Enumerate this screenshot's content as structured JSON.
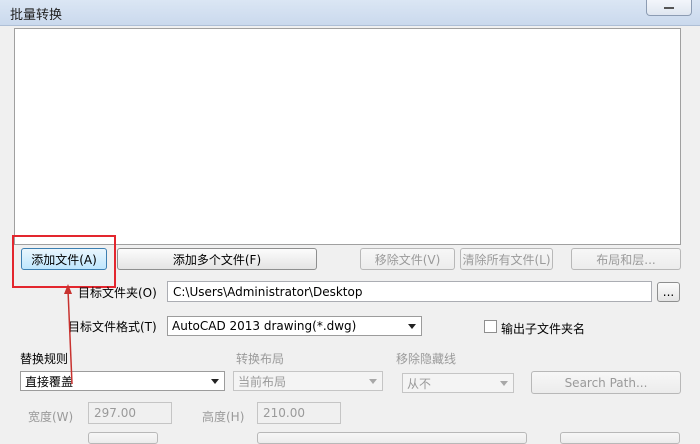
{
  "window": {
    "title": "批量转换"
  },
  "buttons": {
    "add_file": "添加文件(A)",
    "add_multiple": "添加多个文件(F)",
    "remove_file": "移除文件(V)",
    "clear_all": "清除所有文件(L)",
    "layouts": "布局和层...",
    "browse": "...",
    "search_path": "Search Path..."
  },
  "target_folder": {
    "label": "目标文件夹(O)",
    "value": "C:\\Users\\Administrator\\Desktop"
  },
  "target_format": {
    "label": "目标文件格式(T)",
    "value": "AutoCAD 2013 drawing(*.dwg)"
  },
  "output_subfolder": {
    "label": "输出子文件夹名",
    "checked": false
  },
  "replace_rule": {
    "label": "替换规则",
    "value": "直接覆盖"
  },
  "convert_layout": {
    "label": "转换布局",
    "value": "当前布局"
  },
  "remove_hidden": {
    "label": "移除隐藏线",
    "value": "从不"
  },
  "width": {
    "label": "宽度(W)",
    "value": "297.00"
  },
  "height": {
    "label": "高度(H)",
    "value": "210.00"
  },
  "colors": {
    "highlight": "#e3262e",
    "arrow": "#c8322f"
  }
}
